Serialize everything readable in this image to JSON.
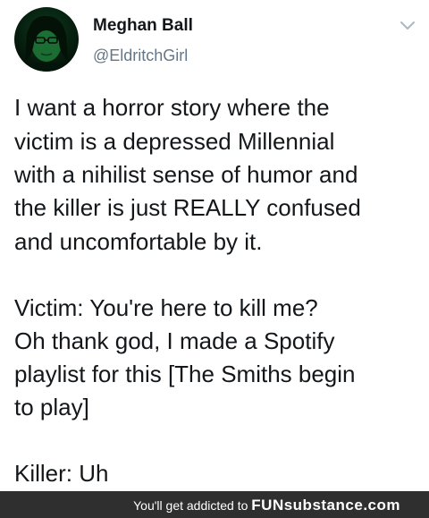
{
  "user": {
    "name": "Meghan Ball",
    "handle": "@EldritchGirl"
  },
  "icons": {
    "avatar": "profile-photo",
    "caret": "chevron-down-icon"
  },
  "tweet": {
    "lines": [
      "I want a horror story where the",
      "victim is a depressed Millennial",
      "with a nihilist sense of humor and",
      "the killer is just REALLY confused",
      "and uncomfortable by it.",
      "Victim: You're here to kill me?",
      "Oh thank god, I made a Spotify",
      "playlist for this [The Smiths begin",
      "to play]",
      "Killer: Uh"
    ]
  },
  "footer": {
    "text": "You'll get addicted to",
    "brand": "FUNsubstance",
    "brand_suffix": ".com"
  },
  "colors": {
    "text": "#14171a",
    "secondary": "#657786",
    "footer_bg": "#2f2f2f",
    "footer_text": "#ffffff"
  }
}
